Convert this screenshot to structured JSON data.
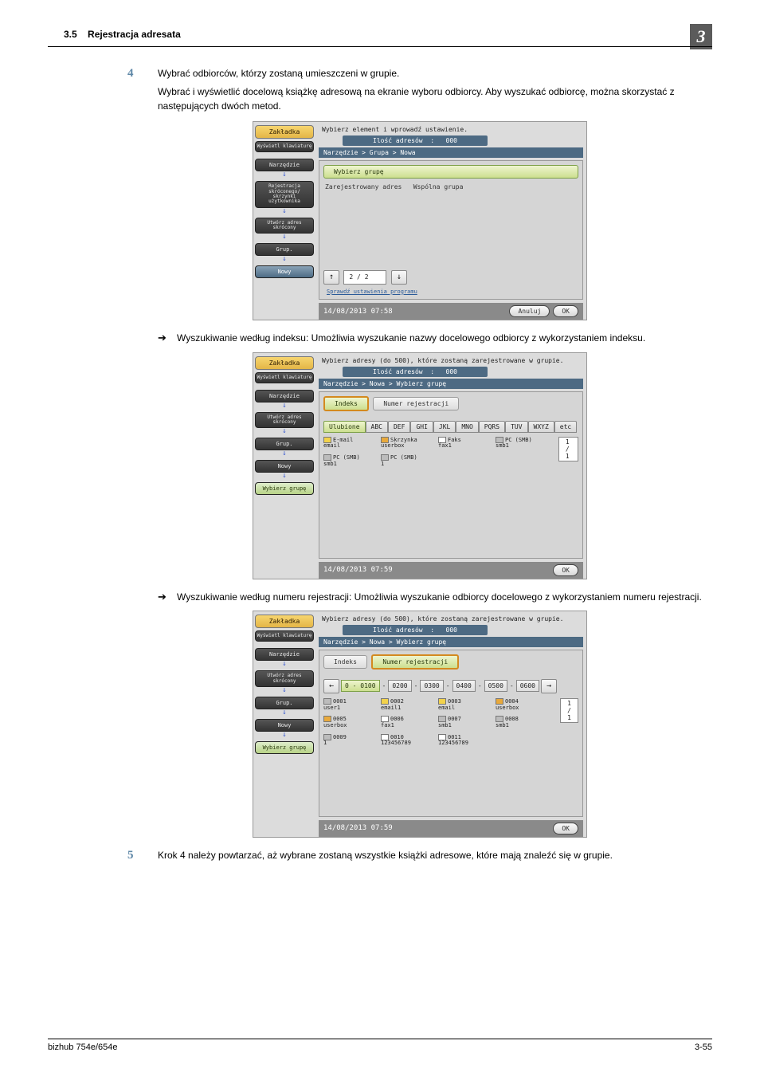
{
  "doc": {
    "section_number": "3.5",
    "section_title": "Rejestracja adresata",
    "chapter": "3",
    "footer_left": "bizhub 754e/654e",
    "footer_right": "3-55"
  },
  "step4": {
    "num": "4",
    "line1": "Wybrać odbiorców, którzy zostaną umieszczeni w grupie.",
    "line2": "Wybrać i wyświetlić docelową książkę adresową na ekranie wyboru odbiorcy. Aby wyszukać odbiorcę, można skorzystać z następujących dwóch metod."
  },
  "bullet_index": "Wyszukiwanie według indeksu: Umożliwia wyszukanie nazwy docelowego odbiorcy z wykorzystaniem indeksu.",
  "bullet_reg": "Wyszukiwanie według numeru rejestracji: Umożliwia wyszukanie odbiorcy docelowego z wykorzystaniem numeru rejestracji.",
  "step5": {
    "num": "5",
    "line1": "Krok 4 należy powtarzać, aż wybrane zostaną wszystkie książki adresowe, które mają znaleźć się w grupie."
  },
  "arrow": "%",
  "panel1": {
    "top_msg": "Wybierz element i wprowadź ustawienie.",
    "count_label": "Ilość adresów",
    "count_value": "000",
    "path": "Narzędzie > Grupa > Nowa",
    "select_group": "Wybierz grupę",
    "hdr_left": "Zarejestrowany adres",
    "hdr_right": "Wspólna grupa",
    "pager": "2 / 2",
    "check": "Sprawdź ustawienia programu",
    "datetime": "14/08/2013   07:58",
    "btn_cancel": "Anuluj",
    "btn_ok": "OK",
    "side": {
      "zak": "Zakładka",
      "wys": "Wyświetl klawiaturę",
      "narz": "Narzędzie",
      "rej": "Rejestracja skróconego/ skrzynki użytkownika",
      "utw": "Utwórz adres skrócony",
      "grup": "Grup.",
      "nowy": "Nowy"
    }
  },
  "panel2": {
    "top_msg": "Wybierz adresy (do 500), które zostaną zarejestrowane w grupie.",
    "count_label": "Ilość adresów",
    "count_value": "000",
    "path": "Narzędzie > Nowa > Wybierz grupę",
    "tab_index": "Indeks",
    "tab_reg": "Numer rejestracji",
    "idx_tabs": [
      "Ulubione",
      "ABC",
      "DEF",
      "GHI",
      "JKL",
      "MNO",
      "PQRS",
      "TUV",
      "WXYZ",
      "etc"
    ],
    "cards": [
      {
        "d": "yl",
        "l1": "E-mail",
        "l2": "email"
      },
      {
        "d": "or",
        "l1": "Skrzynka",
        "l2": "userbox"
      },
      {
        "d": "wh",
        "l1": "Faks",
        "l2": "fax1"
      },
      {
        "d": "gr",
        "l1": "PC (SMB)",
        "l2": "smb1"
      },
      {
        "d": "gr",
        "l1": "PC (SMB)",
        "l2": "smb1"
      },
      {
        "d": "gr",
        "l1": "PC (SMB)",
        "l2": "1"
      }
    ],
    "page_ind": "1 /  1",
    "datetime": "14/08/2013   07:59",
    "btn_ok": "OK",
    "side": {
      "zak": "Zakładka",
      "wys": "Wyświetl klawiaturę",
      "narz": "Narzędzie",
      "utw": "Utwórz adres skrócony",
      "grup": "Grup.",
      "nowy": "Nowy",
      "sel": "Wybierz grupę"
    }
  },
  "panel3": {
    "top_msg": "Wybierz adresy (do 500), które zostaną zarejestrowane w grupie.",
    "count_label": "Ilość adresów",
    "count_value": "000",
    "path": "Narzędzie > Nowa > Wybierz grupę",
    "tab_index": "Indeks",
    "tab_reg": "Numer rejestracji",
    "ranges": [
      "0 - 0100",
      "0200",
      "0300",
      "0400",
      "0500",
      "0600"
    ],
    "cards": [
      {
        "d": "gr",
        "l1": "0001",
        "l2": "user1"
      },
      {
        "d": "yl",
        "l1": "0002",
        "l2": "email1"
      },
      {
        "d": "yl",
        "l1": "0003",
        "l2": "email"
      },
      {
        "d": "or",
        "l1": "0004",
        "l2": "userbox"
      },
      {
        "d": "or",
        "l1": "0005",
        "l2": "userbox"
      },
      {
        "d": "wh",
        "l1": "0006",
        "l2": "fax1"
      },
      {
        "d": "gr",
        "l1": "0007",
        "l2": "smb1"
      },
      {
        "d": "gr",
        "l1": "0008",
        "l2": "smb1"
      },
      {
        "d": "gr",
        "l1": "0009",
        "l2": "1"
      },
      {
        "d": "wh",
        "l1": "0010",
        "l2": "123456789"
      },
      {
        "d": "wh",
        "l1": "0011",
        "l2": "123456789"
      }
    ],
    "page_ind": "1 /  1",
    "datetime": "14/08/2013   07:59",
    "btn_ok": "OK",
    "side": {
      "zak": "Zakładka",
      "wys": "Wyświetl klawiaturę",
      "narz": "Narzędzie",
      "utw": "Utwórz adres skrócony",
      "grup": "Grup.",
      "nowy": "Nowy",
      "sel": "Wybierz grupę"
    }
  }
}
